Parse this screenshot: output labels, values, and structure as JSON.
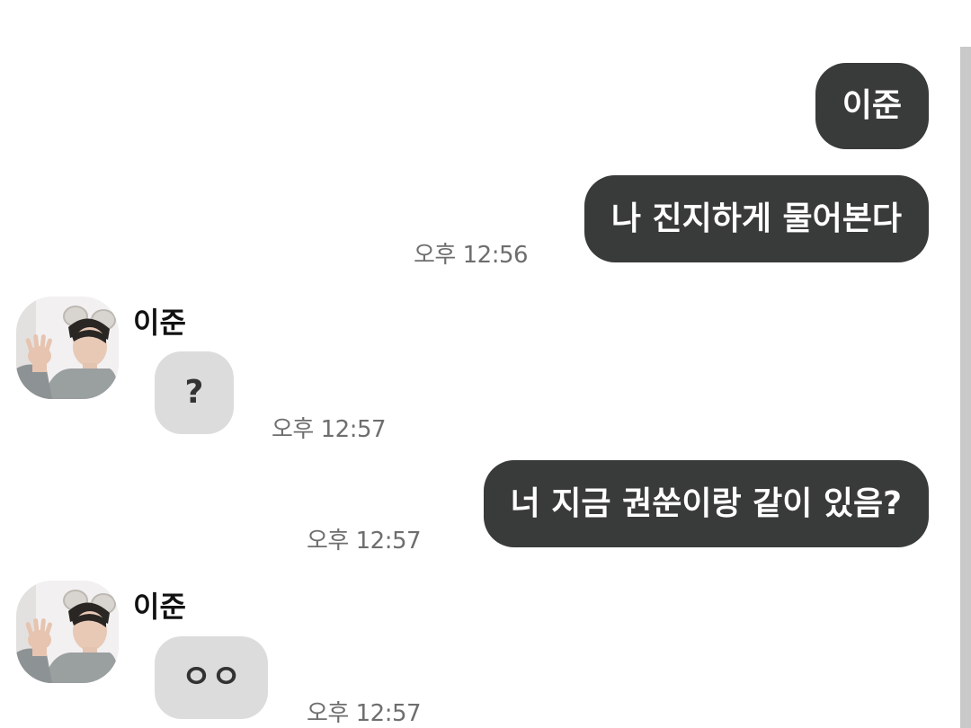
{
  "messages": [
    {
      "from": "me",
      "text": "이준"
    },
    {
      "from": "me",
      "text": "나 진지하게 물어본다",
      "time": "오후 12:56"
    },
    {
      "from": "contact",
      "sender": "이준",
      "text": "?",
      "time": "오후 12:57"
    },
    {
      "from": "me",
      "text": "너 지금 권쑨이랑 같이 있음?",
      "time": "오후 12:57"
    },
    {
      "from": "contact",
      "sender": "이준",
      "text": "ㅇㅇ",
      "time": "오후 12:57"
    }
  ]
}
